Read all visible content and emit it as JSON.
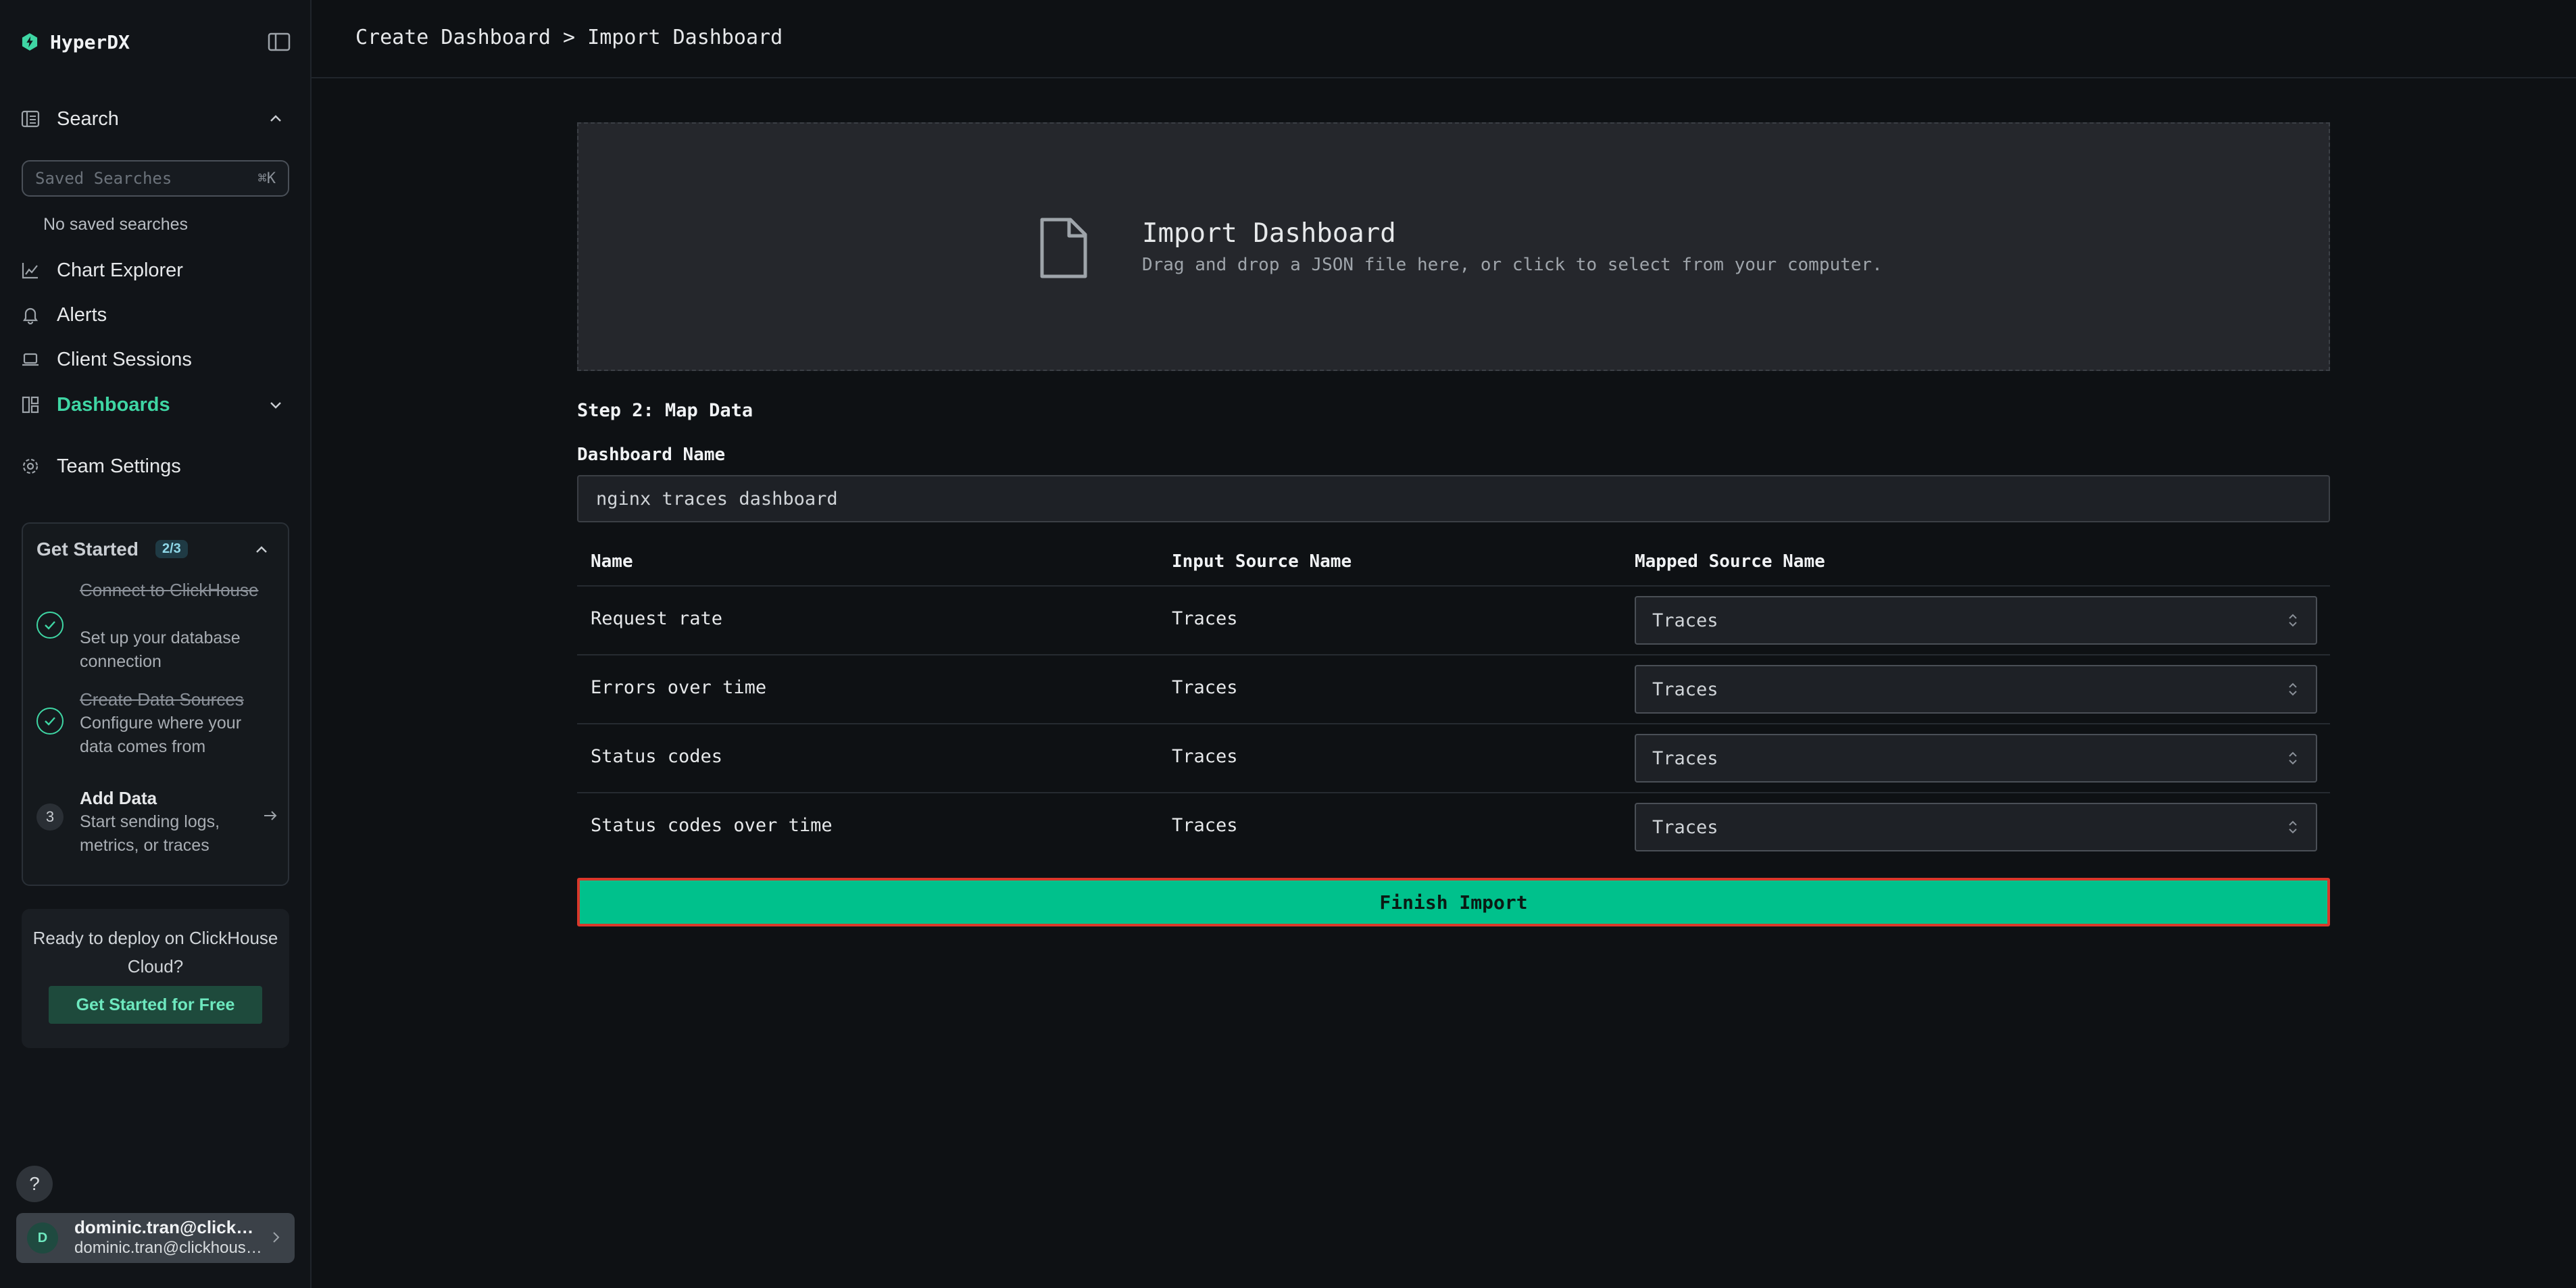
{
  "app": {
    "name": "HyperDX",
    "accent": "#3fd6a4"
  },
  "sidebar": {
    "collapse_icon": "sidebar-collapse-icon",
    "search": {
      "label": "Search",
      "placeholder": "Saved Searches",
      "shortcut": "⌘K",
      "empty": "No saved searches"
    },
    "items": [
      {
        "label": "Chart Explorer",
        "icon": "chart-line-icon"
      },
      {
        "label": "Alerts",
        "icon": "bell-icon"
      },
      {
        "label": "Client Sessions",
        "icon": "laptop-icon"
      },
      {
        "label": "Dashboards",
        "icon": "layout-icon",
        "active": true
      },
      {
        "label": "Team Settings",
        "icon": "gear-icon"
      }
    ],
    "get_started": {
      "title": "Get Started",
      "progress": "2/3",
      "steps": [
        {
          "title": "Connect to ClickHouse",
          "desc": "Set up your database connection",
          "done": true
        },
        {
          "title": "Create Data Sources",
          "desc": "Configure where your data comes from",
          "done": true
        },
        {
          "number": "3",
          "title": "Add Data",
          "desc": "Start sending logs, metrics, or traces",
          "done": false
        }
      ]
    },
    "deploy": {
      "text": "Ready to deploy on ClickHouse Cloud?",
      "button": "Get Started for Free"
    },
    "help": "?",
    "user": {
      "initial": "D",
      "name": "dominic.tran@clickhouse.com",
      "email": "dominic.tran@clickhouse.com"
    }
  },
  "header": {
    "breadcrumb": "Create Dashboard > Import Dashboard"
  },
  "import": {
    "title": "Import Dashboard",
    "subtitle": "Drag and drop a JSON file here, or click to select from your computer."
  },
  "mapping": {
    "step_title": "Step 2: Map Data",
    "name_label": "Dashboard Name",
    "name_value": "nginx traces dashboard",
    "columns": [
      "Name",
      "Input Source Name",
      "Mapped Source Name"
    ],
    "rows": [
      {
        "name": "Request rate",
        "input": "Traces",
        "mapped": "Traces"
      },
      {
        "name": "Errors over time",
        "input": "Traces",
        "mapped": "Traces"
      },
      {
        "name": "Status codes",
        "input": "Traces",
        "mapped": "Traces"
      },
      {
        "name": "Status codes over time",
        "input": "Traces",
        "mapped": "Traces"
      }
    ],
    "finish": "Finish Import"
  }
}
